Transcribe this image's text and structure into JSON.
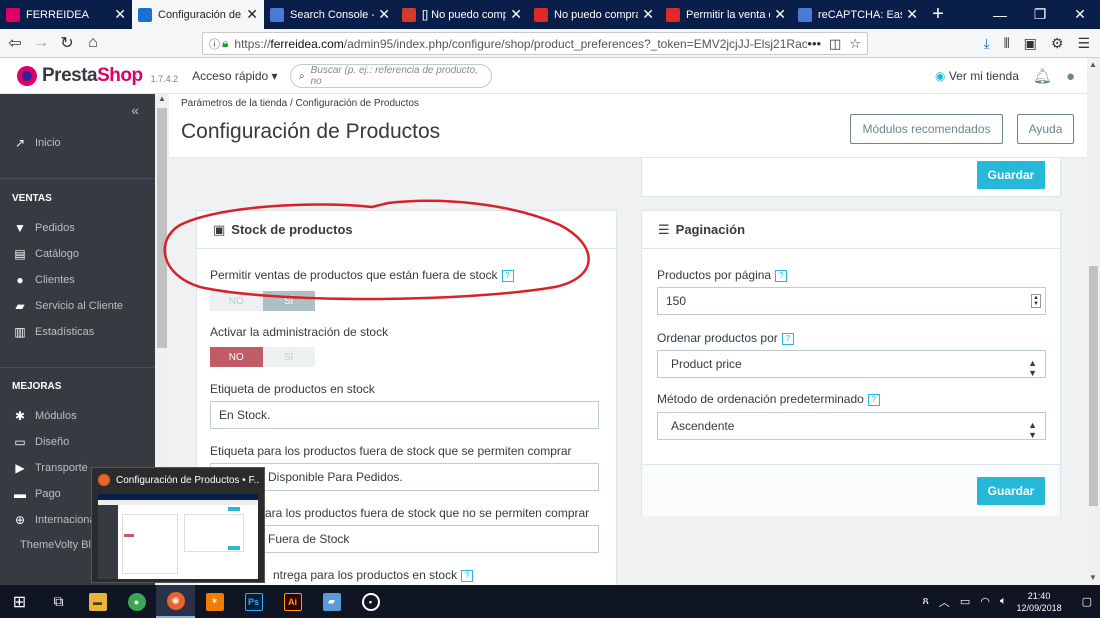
{
  "browser": {
    "tabs": [
      {
        "label": "FERREIDEA",
        "fav_color": "#df0067",
        "active": false
      },
      {
        "label": "Configuración de P",
        "fav_color": "#1a6fd4",
        "active": true
      },
      {
        "label": "Search Console - Pa",
        "fav_color": "#4a7bd4",
        "active": false
      },
      {
        "label": "[] No puedo compr",
        "fav_color": "#d33b2c",
        "active": false
      },
      {
        "label": "No puedo comprar",
        "fav_color": "#e02a2a",
        "active": false
      },
      {
        "label": "Permitir la venta de",
        "fav_color": "#e02a2a",
        "active": false
      },
      {
        "label": "reCAPTCHA: Easy o",
        "fav_color": "#4a7bd4",
        "active": false
      }
    ],
    "url_prefix": "https://",
    "url_domain": "ferreidea.com",
    "url_path": "/admin95/index.php/configure/shop/product_preferences?_token=EMV2jcjJJ-Elsj21Rao",
    "url_more": "•••"
  },
  "header": {
    "logo_text_a": "Presta",
    "logo_text_b": "Shop",
    "version": "1.7.4.2",
    "quick_access": "Acceso rápido ▾",
    "search_placeholder": "Buscar (p. ej.: referencia de producto, no",
    "view_store": "Ver mi tienda"
  },
  "sidebar": {
    "home": "Inicio",
    "sections": [
      {
        "title": "VENTAS",
        "items": [
          "Pedidos",
          "Catálogo",
          "Clientes",
          "Servicio al Cliente",
          "Estadísticas"
        ]
      },
      {
        "title": "MEJORAS",
        "items": [
          "Módulos",
          "Diseño",
          "Transporte",
          "Pago",
          "Internacional",
          "ThemeVolty Blog"
        ]
      }
    ]
  },
  "page": {
    "breadcrumb_a": "Parámetros de la tienda",
    "breadcrumb_b": "Configuración de Productos",
    "title": "Configuración de Productos",
    "btn_modules": "Módulos recomendados",
    "btn_help": "Ayuda",
    "save": "Guardar"
  },
  "stock_panel": {
    "title": "Stock de productos",
    "allow_oos_label": "Permitir ventas de productos que están fuera de stock",
    "allow_oos": {
      "no": "NO",
      "yes": "SÍ",
      "value": "SÍ"
    },
    "manage_stock_label": "Activar la administración de stock",
    "manage_stock": {
      "no": "NO",
      "yes": "SÍ",
      "value": "NO"
    },
    "instock_label": "Etiqueta de productos en stock",
    "instock_value": "En Stock.",
    "oos_allowed_label": "Etiqueta para los productos fuera de stock que se permiten comprar",
    "oos_allowed_value": "Disponible Para Pedidos.",
    "oos_denied_label": "ara los productos fuera de stock que no se permiten comprar",
    "oos_denied_value": "Fuera de Stock",
    "delivery_label": "ntrega para los productos en stock"
  },
  "pagination_panel": {
    "title": "Paginación",
    "per_page_label": "Productos por página",
    "per_page_value": "150",
    "order_by_label": "Ordenar productos por",
    "order_by_value": "Product price",
    "order_method_label": "Método de ordenación predeterminado",
    "order_method_value": "Ascendente",
    "save": "Guardar"
  },
  "preview": {
    "title": "Configuración de Productos • F..."
  },
  "taskbar": {
    "time": "21:40",
    "date": "12/09/2018"
  },
  "colors": {
    "accent": "#25b9d7",
    "sidebar_bg": "#363a41",
    "danger": "#c05c67",
    "annotation": "#d8222a"
  }
}
